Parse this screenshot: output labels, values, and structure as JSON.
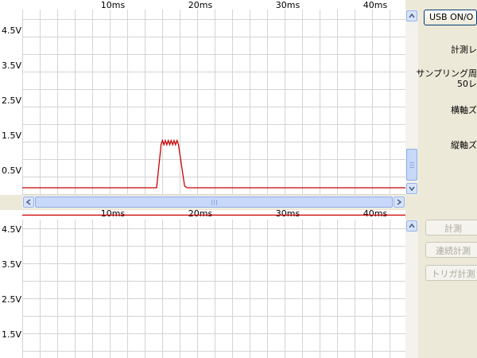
{
  "scope_top": {
    "x_ticks": [
      "10ms",
      "20ms",
      "30ms",
      "40ms"
    ],
    "y_ticks": [
      "4.5V",
      "3.5V",
      "2.5V",
      "1.5V",
      "0.5V"
    ],
    "trace_color": "#cc0000",
    "trace": {
      "baseline_v": 0.0,
      "pulse_start_ms": 15.0,
      "pulse_rise_end_ms": 15.5,
      "pulse_fall_start_ms": 17.5,
      "pulse_end_ms": 18.2,
      "pulse_peak_v": 1.35
    }
  },
  "scope_bottom": {
    "x_ticks": [
      "10ms",
      "20ms",
      "30ms",
      "40ms"
    ],
    "y_ticks": [
      "4.5V",
      "3.5V",
      "2.5V",
      "1.5V"
    ],
    "trace_color": "#cc0000",
    "trace": {
      "level_v": 4.9
    }
  },
  "controls": {
    "usb_button": "USB ON/O",
    "measure_label": "計測レ",
    "sampling_label": "サンプリング周",
    "sampling_value": "50レ",
    "h_zoom_label": "横軸ズ",
    "v_zoom_label": "縦軸ズ",
    "measure_button": "計測",
    "continuous_button": "連続計測",
    "trigger_button": "トリガ計測"
  }
}
